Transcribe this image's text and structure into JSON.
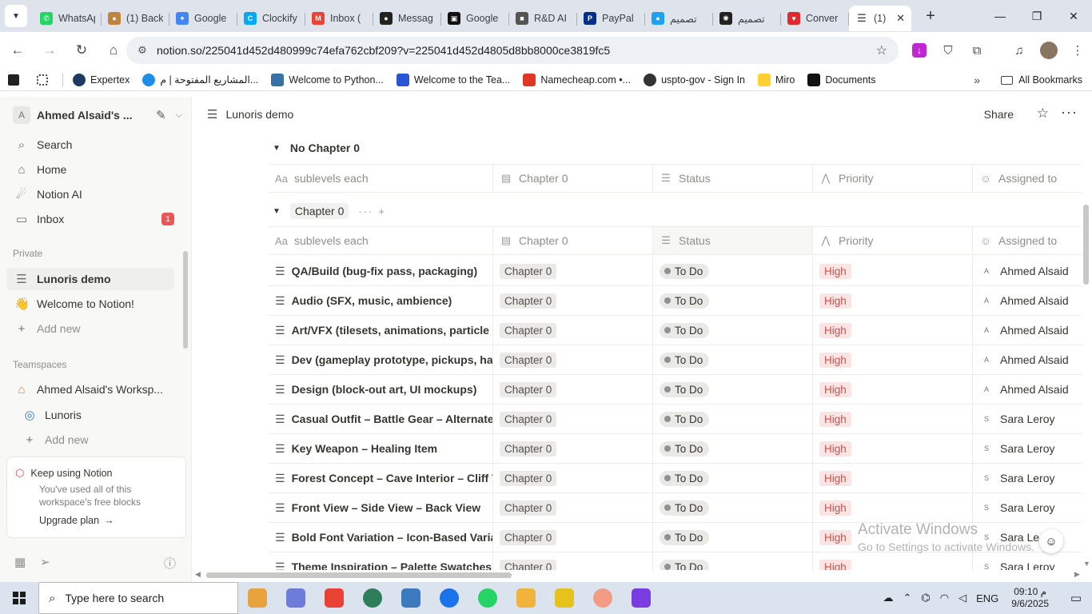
{
  "browser": {
    "tabs": [
      {
        "title": "WhatsApp",
        "color": "#25d366",
        "glyph": "✆"
      },
      {
        "title": "(1) Back",
        "color": "#c0843f",
        "glyph": "●"
      },
      {
        "title": "Google",
        "color": "#4285f4",
        "glyph": "✦"
      },
      {
        "title": "Clockify",
        "color": "#03a9f4",
        "glyph": "C"
      },
      {
        "title": "Inbox (",
        "color": "#ea4335",
        "glyph": "M"
      },
      {
        "title": "Messag",
        "color": "#222222",
        "glyph": "●"
      },
      {
        "title": "Google",
        "color": "#111111",
        "glyph": "▣"
      },
      {
        "title": "R&D AI",
        "color": "#555555",
        "glyph": "■"
      },
      {
        "title": "PayPal",
        "color": "#003087",
        "glyph": "P"
      },
      {
        "title": "تصميم",
        "color": "#1da1f2",
        "glyph": "●"
      },
      {
        "title": "تصميم",
        "color": "#222222",
        "glyph": "✺"
      },
      {
        "title": "Conver",
        "color": "#e0282e",
        "glyph": "♥"
      }
    ],
    "active_tab": {
      "title": "(1)",
      "close": "✕"
    },
    "new_tab": "+",
    "window_controls": [
      "—",
      "❐",
      "✕"
    ],
    "url": "notion.so/225041d452d480999c74efa762cbf209?v=225041d452d4805d8bb8000ce3819fc5",
    "bookmarks": [
      {
        "label": "",
        "color": "#222222"
      },
      {
        "label": "",
        "color": "#444444"
      },
      {
        "label": "Expertex",
        "color": "#1e3a5f"
      },
      {
        "label": "المشاريع المفتوحة | م...",
        "color": "#1d8ee6"
      },
      {
        "label": "Welcome to Python...",
        "color": "#3772a4"
      },
      {
        "label": "Welcome to the Tea...",
        "color": "#2a54d6"
      },
      {
        "label": "Namecheap.com •...",
        "color": "#de3723"
      },
      {
        "label": "uspto-gov - Sign In",
        "color": "#333333"
      },
      {
        "label": "Miro",
        "color": "#ffd02f"
      },
      {
        "label": "Documents",
        "color": "#111111"
      }
    ],
    "all_bookmarks": "All Bookmarks",
    "more_bookmarks": "»"
  },
  "sidebar": {
    "workspace_initial": "A",
    "workspace_name": "Ahmed Alsaid's ...",
    "nav": [
      {
        "label": "Search",
        "icon": "⌕"
      },
      {
        "label": "Home",
        "icon": "⌂"
      },
      {
        "label": "Notion AI",
        "icon": "☄"
      },
      {
        "label": "Inbox",
        "icon": "▭",
        "badge": "1"
      }
    ],
    "private_label": "Private",
    "private_pages": [
      {
        "label": "Lunoris demo",
        "icon": "☰",
        "active": true
      },
      {
        "label": "Welcome to Notion!",
        "icon": "👋",
        "active": false
      }
    ],
    "add_new": "Add new",
    "teamspaces_label": "Teamspaces",
    "teamspace_name": "Ahmed Alsaid's Worksp...",
    "teamspace_pages": [
      {
        "label": "Lunoris",
        "icon": "◎"
      }
    ],
    "promo": {
      "title": "Keep using Notion",
      "desc": "You've used all of this workspace's free blocks",
      "link": "Upgrade plan"
    }
  },
  "topbar": {
    "page_title": "Lunoris demo",
    "share": "Share"
  },
  "database": {
    "group_empty": "No Chapter 0",
    "group_main": "Chapter 0",
    "columns": [
      {
        "label": "sublevels each",
        "icon": "Aa"
      },
      {
        "label": "Chapter 0",
        "icon": "▤"
      },
      {
        "label": "Status",
        "icon": "☰"
      },
      {
        "label": "Priority",
        "icon": "⋀"
      },
      {
        "label": "Assigned to",
        "icon": "☺"
      }
    ],
    "rows": [
      {
        "name": "QA/Build (bug-fix pass, packaging)",
        "chapter": "Chapter 0",
        "status": "To Do",
        "priority": "High",
        "initial": "A",
        "assignee": "Ahmed Alsaid"
      },
      {
        "name": "Audio (SFX, music, ambience)",
        "chapter": "Chapter 0",
        "status": "To Do",
        "priority": "High",
        "initial": "A",
        "assignee": "Ahmed Alsaid"
      },
      {
        "name": "Art/VFX (tilesets, animations, particle effects)",
        "chapter": "Chapter 0",
        "status": "To Do",
        "priority": "High",
        "initial": "A",
        "assignee": "Ahmed Alsaid"
      },
      {
        "name": "Dev (gameplay prototype, pickups, hazards)",
        "chapter": "Chapter 0",
        "status": "To Do",
        "priority": "High",
        "initial": "A",
        "assignee": "Ahmed Alsaid"
      },
      {
        "name": "Design (block-out art, UI mockups)",
        "chapter": "Chapter 0",
        "status": "To Do",
        "priority": "High",
        "initial": "A",
        "assignee": "Ahmed Alsaid"
      },
      {
        "name": "Casual Outfit – Battle Gear – Alternate Skin",
        "chapter": "Chapter 0",
        "status": "To Do",
        "priority": "High",
        "initial": "S",
        "assignee": "Sara Leroy"
      },
      {
        "name": "Key Weapon – Healing Item",
        "chapter": "Chapter 0",
        "status": "To Do",
        "priority": "High",
        "initial": "S",
        "assignee": "Sara Leroy"
      },
      {
        "name": "Forest Concept – Cave Interior – Cliff Top",
        "chapter": "Chapter 0",
        "status": "To Do",
        "priority": "High",
        "initial": "S",
        "assignee": "Sara Leroy"
      },
      {
        "name": "Front View – Side View – Back View",
        "chapter": "Chapter 0",
        "status": "To Do",
        "priority": "High",
        "initial": "S",
        "assignee": "Sara Leroy"
      },
      {
        "name": "Bold Font Variation – Icon-Based Variation",
        "chapter": "Chapter 0",
        "status": "To Do",
        "priority": "High",
        "initial": "S",
        "assignee": "Sara Le"
      },
      {
        "name": "Theme Inspiration – Palette Swatches",
        "chapter": "Chapter 0",
        "status": "To Do",
        "priority": "High",
        "initial": "S",
        "assignee": "Sara Leroy"
      }
    ],
    "colors": {
      "priority_bg": "#fbe4e4",
      "priority_text": "#c4554d"
    }
  },
  "windows_watermark": {
    "line1": "Activate Windows",
    "line2": "Go to Settings to activate Windows."
  },
  "taskbar": {
    "search_placeholder": "Type here to search",
    "apps": [
      "#e8a33c",
      "#6e7bd9",
      "#e94235",
      "#2e7d5b",
      "#3d7bbf",
      "#1a73e8",
      "#25d366",
      "#f0b33b",
      "#e6c21c",
      "#f29c86",
      "#7a3ee0"
    ],
    "lang": "ENG",
    "time": "09:10 م",
    "date": "9/6/2025"
  }
}
